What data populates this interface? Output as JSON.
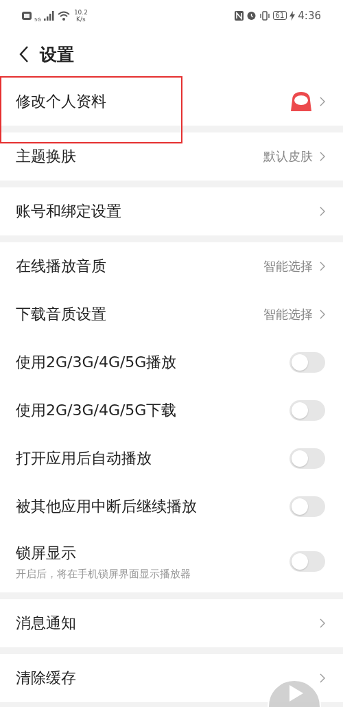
{
  "status_bar": {
    "network": "5G",
    "speed": "10.2",
    "speed_unit": "K/s",
    "battery": "61",
    "time": "4:36"
  },
  "header": {
    "title": "设置"
  },
  "groups": [
    [
      {
        "kind": "link",
        "label": "修改个人资料",
        "avatar": true,
        "highlighted": true
      }
    ],
    [
      {
        "kind": "link",
        "label": "主题换肤",
        "value": "默认皮肤"
      }
    ],
    [
      {
        "kind": "link",
        "label": "账号和绑定设置"
      }
    ],
    [
      {
        "kind": "link",
        "label": "在线播放音质",
        "value": "智能选择"
      },
      {
        "kind": "link",
        "label": "下载音质设置",
        "value": "智能选择"
      },
      {
        "kind": "toggle",
        "label": "使用2G/3G/4G/5G播放",
        "on": false
      },
      {
        "kind": "toggle",
        "label": "使用2G/3G/4G/5G下载",
        "on": false
      },
      {
        "kind": "toggle",
        "label": "打开应用后自动播放",
        "on": false
      },
      {
        "kind": "toggle",
        "label": "被其他应用中断后继续播放",
        "on": false
      },
      {
        "kind": "toggle",
        "label": "锁屏显示",
        "subtitle": "开启后，将在手机锁屏界面显示播放器",
        "on": false
      }
    ],
    [
      {
        "kind": "link",
        "label": "消息通知"
      }
    ],
    [
      {
        "kind": "link",
        "label": "清除缓存"
      }
    ]
  ],
  "play_button": true
}
